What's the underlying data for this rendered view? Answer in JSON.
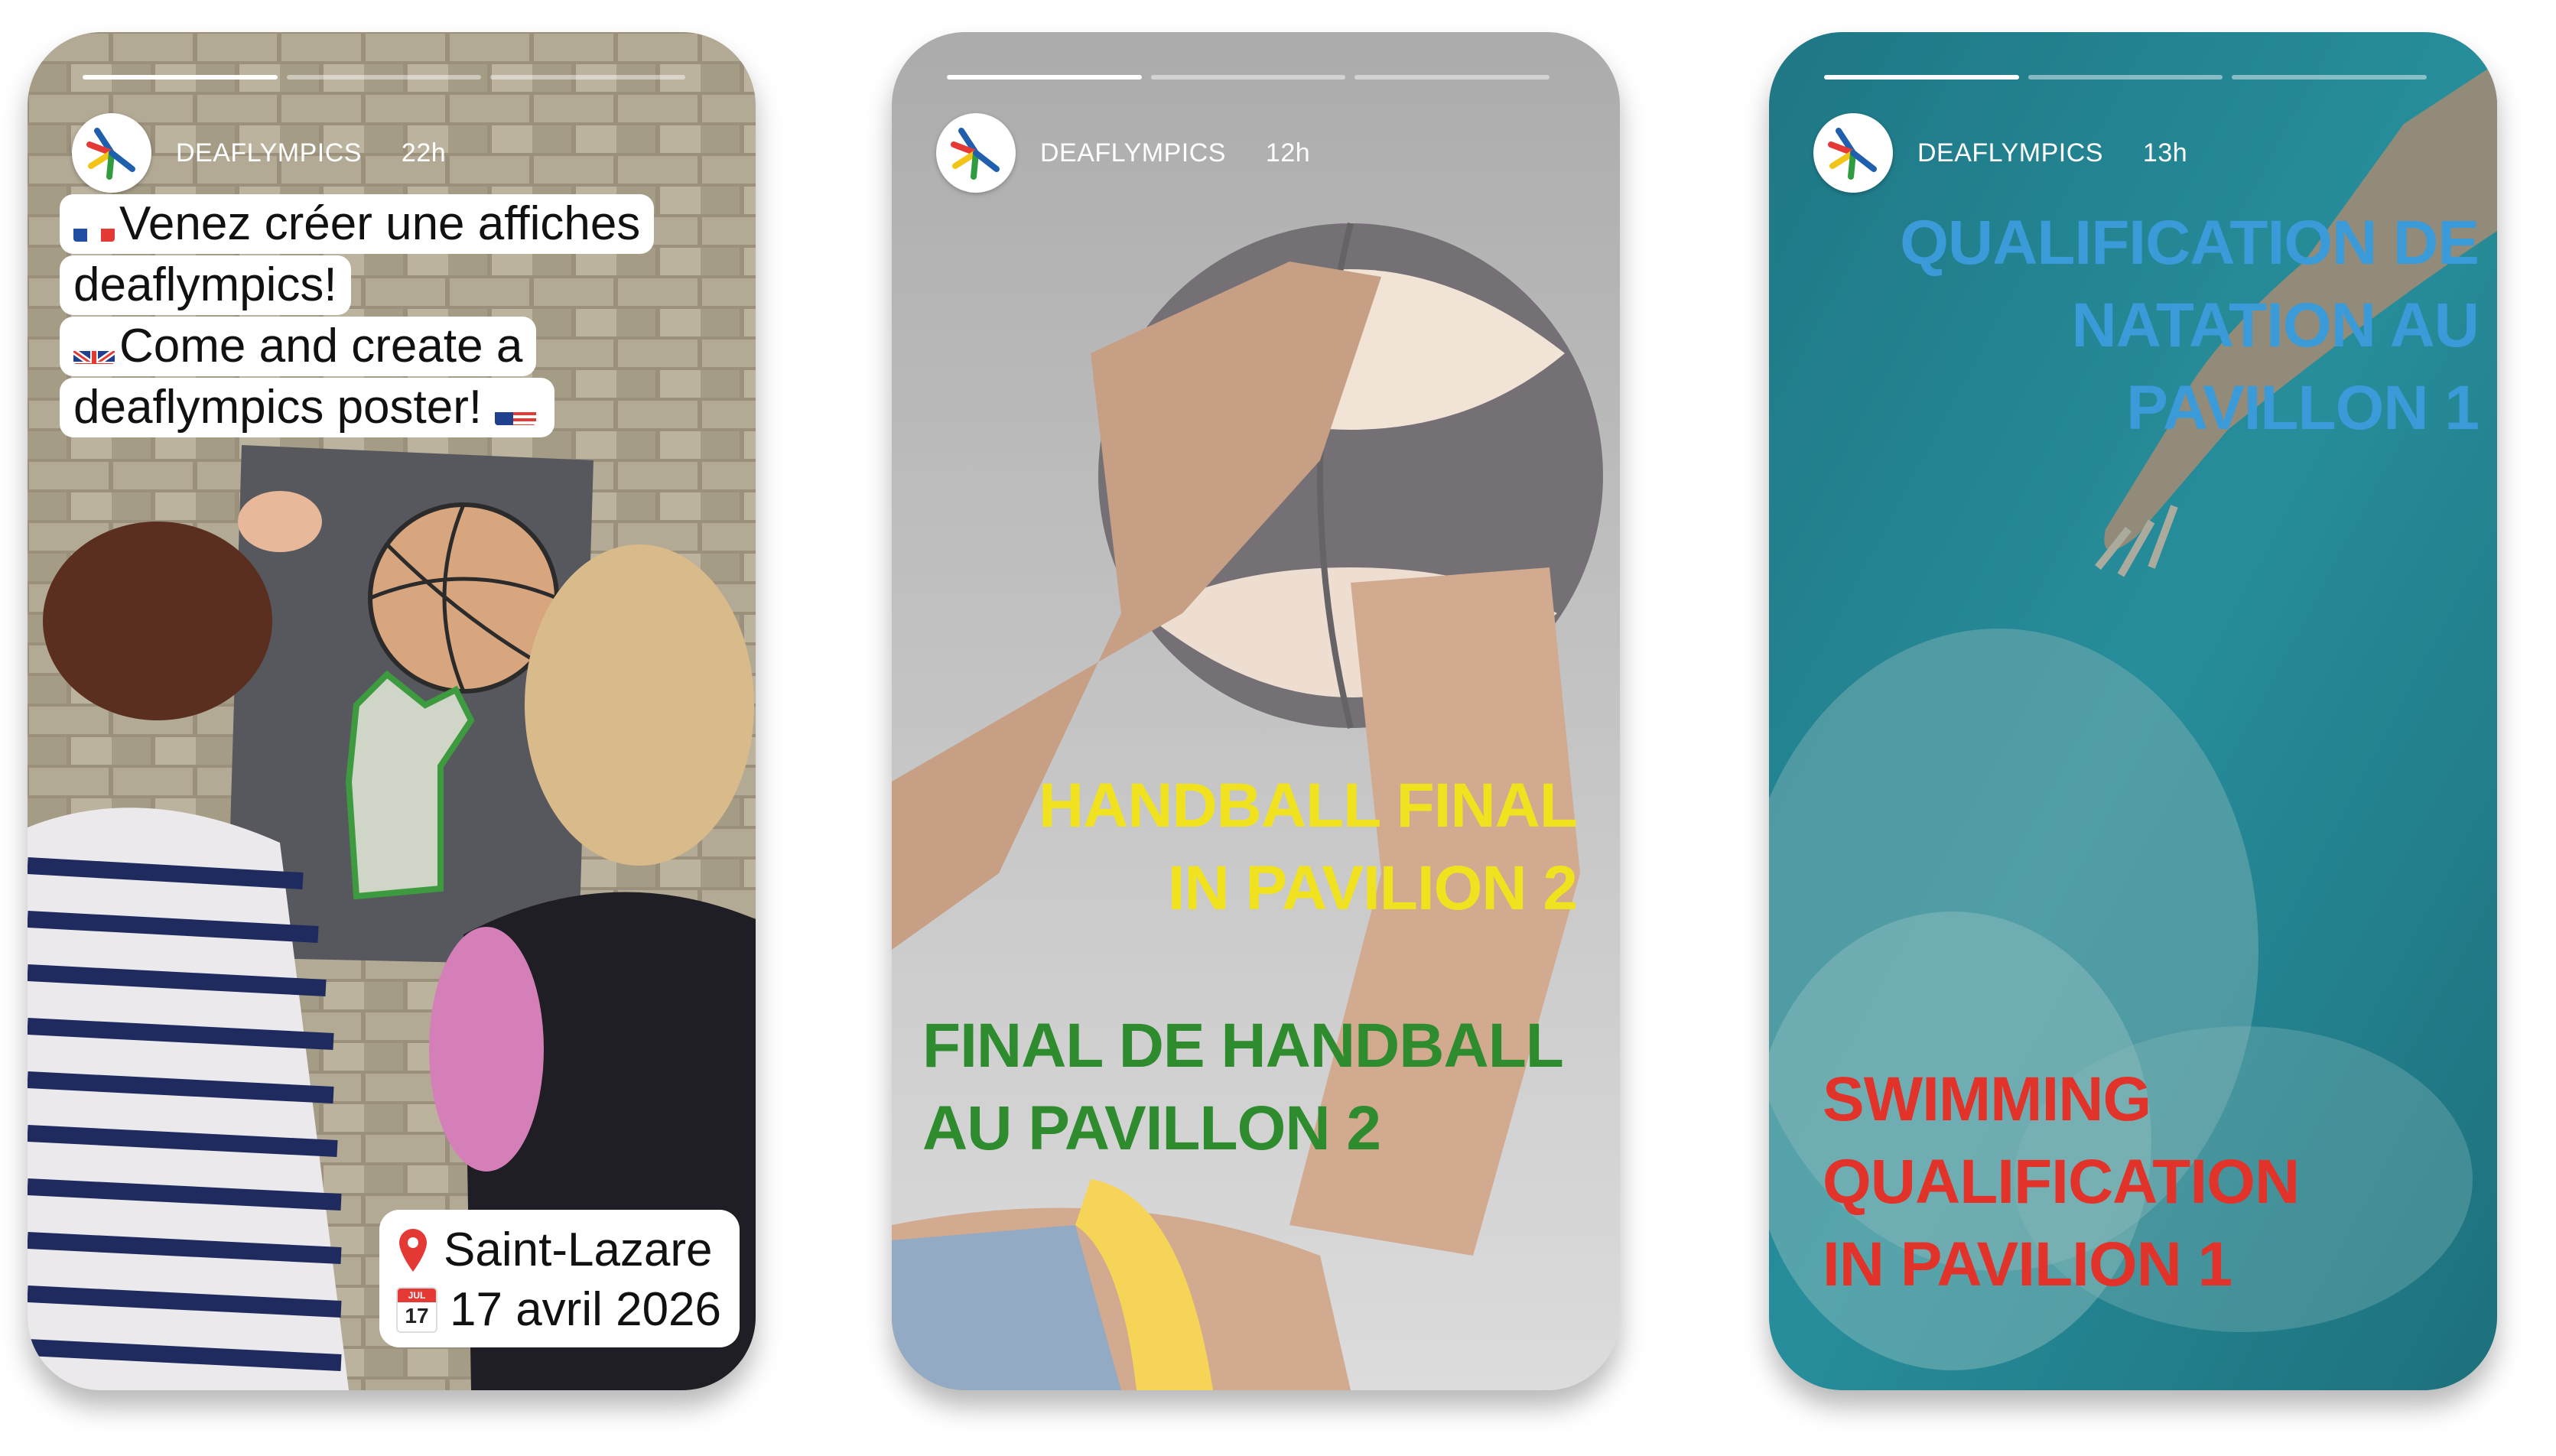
{
  "stories": [
    {
      "account": "DEAFLYMPICS",
      "time": "22h",
      "caption_lines": [
        "Venez créer une affiches",
        "deaflympics!",
        "Come and create a",
        "deaflympics poster!"
      ],
      "location": "Saint-Lazare",
      "date": "17 avril 2026",
      "calendar_month": "JUL",
      "calendar_day": "17"
    },
    {
      "account": "DEAFLYMPICS",
      "time": "12h",
      "headline_en": [
        "HANDBALL FINAL",
        "IN PAVILION 2"
      ],
      "headline_fr": [
        "FINAL DE HANDBALL",
        "AU PAVILLON 2"
      ]
    },
    {
      "account": "DEAFLYMPICS",
      "time": "13h",
      "headline_fr": [
        "QUALIFICATION DE",
        "NATATION AU",
        "PAVILLON 1"
      ],
      "headline_en": [
        "SWIMMING",
        "QUALIFICATION",
        "IN PAVILION 1"
      ]
    }
  ],
  "colors": {
    "yellow": "#f1e21f",
    "green": "#2e8b2e",
    "blue": "#3a9bd8",
    "red": "#e2332a"
  },
  "icons": [
    "deaflympics-logo-icon",
    "pin-icon",
    "calendar-icon",
    "flag-fr-icon",
    "flag-uk-icon",
    "flag-us-icon"
  ]
}
